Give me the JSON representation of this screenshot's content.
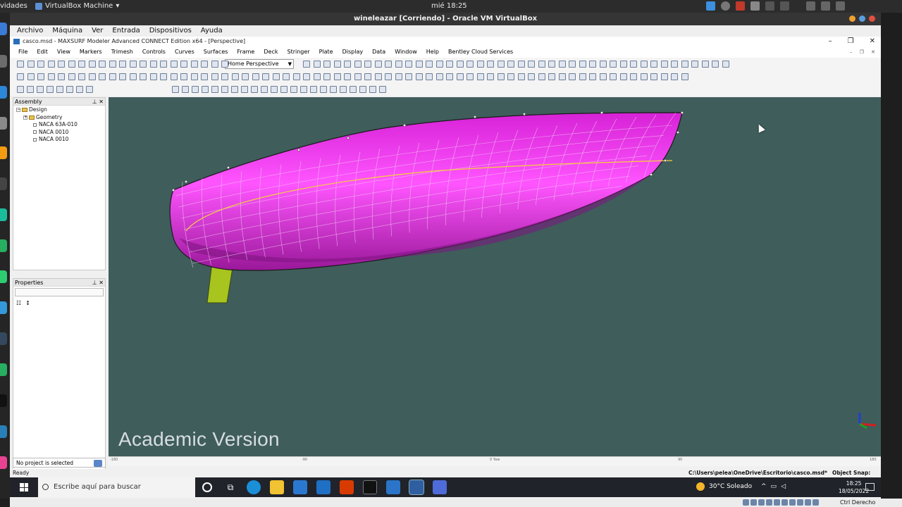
{
  "host_bar": {
    "activities": "vidades",
    "vm_app": "VirtualBox Machine",
    "clock": "mié 18:25"
  },
  "vbox": {
    "window_title": "wineleazar [Corriendo] - Oracle VM VirtualBox",
    "menu": [
      "Archivo",
      "Máquina",
      "Ver",
      "Entrada",
      "Dispositivos",
      "Ayuda"
    ],
    "host_key": "Ctrl Derecho"
  },
  "maxsurf": {
    "title": "casco.msd - MAXSURF Modeler Advanced CONNECT Edition x64 - [Perspective]",
    "menu": [
      "File",
      "Edit",
      "View",
      "Markers",
      "Trimesh",
      "Controls",
      "Curves",
      "Surfaces",
      "Frame",
      "Deck",
      "Stringer",
      "Plate",
      "Display",
      "Data",
      "Window",
      "Help",
      "Bentley Cloud Services"
    ],
    "view_select": "Home Perspective",
    "assembly": {
      "title": "Assembly",
      "root": "Design",
      "group": "Geometry",
      "items": [
        "NACA 63A-010",
        "NACA 0010",
        "NACA 0010"
      ]
    },
    "properties": {
      "title": "Properties"
    },
    "watermark": "Academic Version",
    "project_status": "No project is selected",
    "status_ready": "Ready",
    "file_path": "C:\\Users\\pelea\\OneDrive\\Escritorio\\casco.msd*",
    "object_snap": "Object Snap: OFF",
    "ruler_labels": [
      "-180",
      "-90",
      "0 Yaw",
      "90",
      "180"
    ]
  },
  "taskbar": {
    "search_placeholder": "Escribe aquí para buscar",
    "weather": "30°C Soleado",
    "time": "18:25",
    "date": "18/05/2022"
  },
  "colors": {
    "hull": "#d622d6",
    "hull_highlight": "#ff55ff",
    "keel": "#a8c41e",
    "viewport_bg": "#3f5d5b"
  }
}
